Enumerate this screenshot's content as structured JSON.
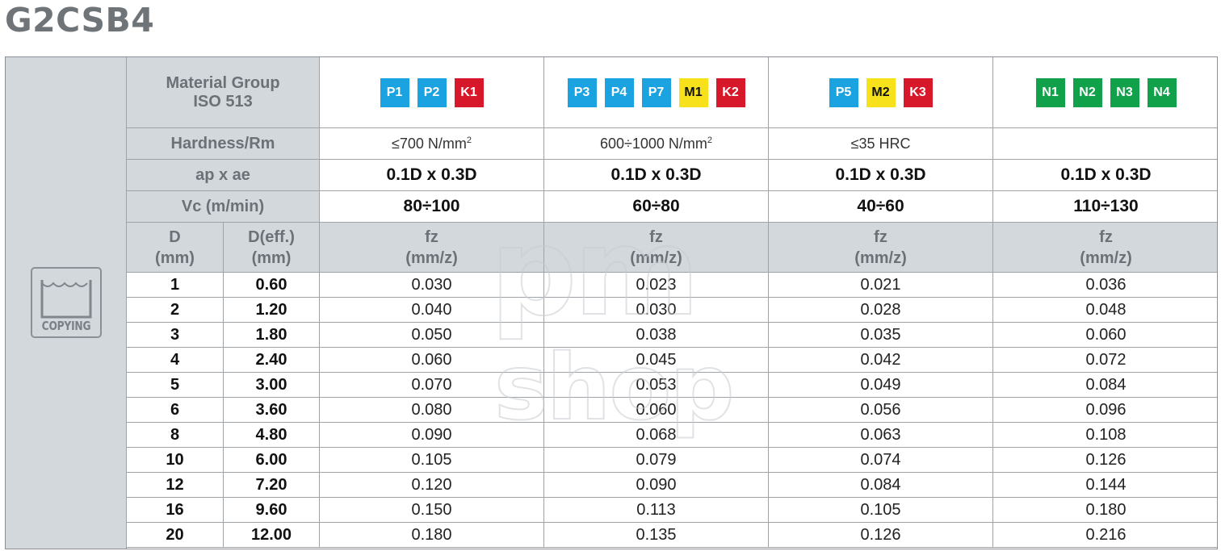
{
  "title": "G2CSB4",
  "side": {
    "icon": "copying-icon",
    "label": "COPYING"
  },
  "header": {
    "material_group_line1": "Material Group",
    "material_group_line2": "ISO 513",
    "hardness_label": "Hardness/Rm",
    "apae_label": "ap x ae",
    "vc_label": "Vc (m/min)",
    "d_label_1": "D",
    "d_label_2": "(mm)",
    "deff_label_1": "D(eff.)",
    "deff_label_2": "(mm)",
    "fz_label_1": "fz",
    "fz_label_2": "(mm/z)"
  },
  "colors": {
    "blue": "#1aa3e0",
    "red": "#d7182a",
    "yellow": "#f6e11a",
    "green": "#12a14b"
  },
  "groups": [
    {
      "badges": [
        {
          "label": "P1",
          "color": "#1aa3e0"
        },
        {
          "label": "P2",
          "color": "#1aa3e0"
        },
        {
          "label": "K1",
          "color": "#d7182a"
        }
      ],
      "hardness": "≤700 N/mm",
      "hardness_sup": "2",
      "apae": "0.1D x 0.3D",
      "vc": "80÷100"
    },
    {
      "badges": [
        {
          "label": "P3",
          "color": "#1aa3e0"
        },
        {
          "label": "P4",
          "color": "#1aa3e0"
        },
        {
          "label": "P7",
          "color": "#1aa3e0"
        },
        {
          "label": "M1",
          "color": "#f6e11a"
        },
        {
          "label": "K2",
          "color": "#d7182a"
        }
      ],
      "hardness": "600÷1000 N/mm",
      "hardness_sup": "2",
      "apae": "0.1D x 0.3D",
      "vc": "60÷80"
    },
    {
      "badges": [
        {
          "label": "P5",
          "color": "#1aa3e0"
        },
        {
          "label": "M2",
          "color": "#f6e11a"
        },
        {
          "label": "K3",
          "color": "#d7182a"
        }
      ],
      "hardness": "≤35 HRC",
      "hardness_sup": "",
      "apae": "0.1D x 0.3D",
      "vc": "40÷60"
    },
    {
      "badges": [
        {
          "label": "N1",
          "color": "#12a14b"
        },
        {
          "label": "N2",
          "color": "#12a14b"
        },
        {
          "label": "N3",
          "color": "#12a14b"
        },
        {
          "label": "N4",
          "color": "#12a14b"
        }
      ],
      "hardness": "",
      "hardness_sup": "",
      "apae": "0.1D x 0.3D",
      "vc": "110÷130"
    }
  ],
  "rows": [
    [
      "1",
      "0.60",
      "0.030",
      "0.023",
      "0.021",
      "0.036"
    ],
    [
      "2",
      "1.20",
      "0.040",
      "0.030",
      "0.028",
      "0.048"
    ],
    [
      "3",
      "1.80",
      "0.050",
      "0.038",
      "0.035",
      "0.060"
    ],
    [
      "4",
      "2.40",
      "0.060",
      "0.045",
      "0.042",
      "0.072"
    ],
    [
      "5",
      "3.00",
      "0.070",
      "0.053",
      "0.049",
      "0.084"
    ],
    [
      "6",
      "3.60",
      "0.080",
      "0.060",
      "0.056",
      "0.096"
    ],
    [
      "8",
      "4.80",
      "0.090",
      "0.068",
      "0.063",
      "0.108"
    ],
    [
      "10",
      "6.00",
      "0.105",
      "0.079",
      "0.074",
      "0.126"
    ],
    [
      "12",
      "7.20",
      "0.120",
      "0.090",
      "0.084",
      "0.144"
    ],
    [
      "16",
      "9.60",
      "0.150",
      "0.113",
      "0.105",
      "0.180"
    ],
    [
      "20",
      "12.00",
      "0.180",
      "0.135",
      "0.126",
      "0.216"
    ]
  ],
  "watermark": {
    "line1": "pm",
    "line2": "shop"
  }
}
